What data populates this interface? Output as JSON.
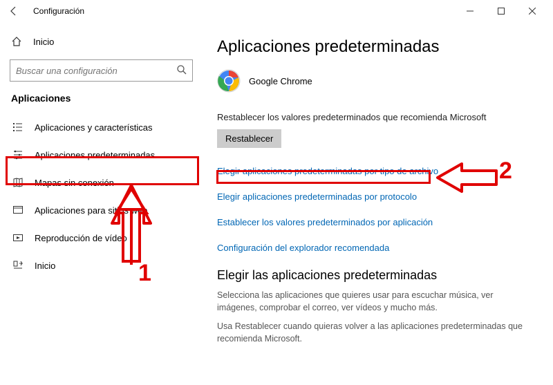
{
  "titlebar": {
    "title": "Configuración"
  },
  "sidebar": {
    "home": "Inicio",
    "search_placeholder": "Buscar una configuración",
    "section": "Aplicaciones",
    "items": [
      {
        "label": "Aplicaciones y características"
      },
      {
        "label": "Aplicaciones predeterminadas"
      },
      {
        "label": "Mapas sin conexión"
      },
      {
        "label": "Aplicaciones para sitios web"
      },
      {
        "label": "Reproducción de vídeo"
      },
      {
        "label": "Inicio"
      }
    ]
  },
  "main": {
    "page_title": "Aplicaciones predeterminadas",
    "browser_name": "Google Chrome",
    "reset_desc": "Restablecer los valores predeterminados que recomienda Microsoft",
    "reset_button": "Restablecer",
    "links": [
      "Elegir aplicaciones predeterminadas por tipo de archivo",
      "Elegir aplicaciones predeterminadas por protocolo",
      "Establecer los valores predeterminados por aplicación",
      "Configuración del explorador recomendada"
    ],
    "sub_heading": "Elegir las aplicaciones predeterminadas",
    "para1": "Selecciona las aplicaciones que quieres usar para escuchar música, ver imágenes, comprobar el correo, ver vídeos y mucho más.",
    "para2": "Usa Restablecer cuando quieras volver a las aplicaciones predeterminadas que recomienda Microsoft."
  },
  "annotations": {
    "label1": "1",
    "label2": "2"
  }
}
